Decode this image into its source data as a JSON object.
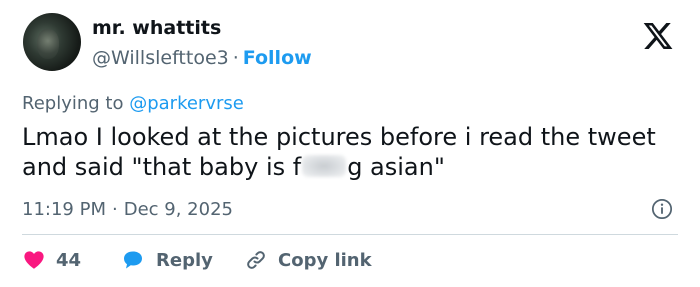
{
  "author": {
    "name": "mr. whattits",
    "handle": "@Willslefttoe3",
    "separator": "·",
    "follow_label": "Follow"
  },
  "brand": {
    "logo_icon": "x-logo-icon"
  },
  "reply_context": {
    "prefix": "Replying to",
    "mention": "@parkervrse"
  },
  "tweet": {
    "text_before": "Lmao I looked at the pictures before i read the tweet and said \"that baby is f",
    "text_after": "g asian\""
  },
  "meta": {
    "time": "11:19 PM",
    "separator": "·",
    "date": "Dec 9, 2025",
    "info_icon": "info-icon"
  },
  "actions": {
    "like": {
      "icon": "heart-icon",
      "count": "44",
      "color": "#f91880"
    },
    "reply": {
      "icon": "speech-bubble-icon",
      "label": "Reply",
      "color": "#1d9bf0"
    },
    "copy": {
      "icon": "link-icon",
      "label": "Copy link"
    }
  },
  "colors": {
    "text": "#0f1419",
    "secondary": "#536471",
    "accent": "#1d9bf0",
    "divider": "#cfd9de"
  }
}
